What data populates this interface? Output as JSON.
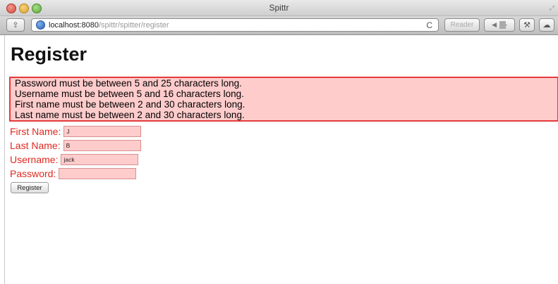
{
  "window": {
    "title": "Spittr"
  },
  "toolbar": {
    "url_host": "localhost:8080",
    "url_path": "/spittr/spitter/register",
    "reader_label": "Reader",
    "back_glyph": "◀",
    "forward_glyph": "▶",
    "reload_glyph": "C"
  },
  "page": {
    "heading": "Register",
    "errors": [
      "Password must be between 5 and 25 characters long.",
      "Username must be between 5 and 16 characters long.",
      "First name must be between 2 and 30 characters long.",
      "Last name must be between 2 and 30 characters long."
    ],
    "form": {
      "first_name_label": "First Name:",
      "first_name_value": "J",
      "last_name_label": "Last Name:",
      "last_name_value": "B",
      "username_label": "Username:",
      "username_value": "jack",
      "password_label": "Password:",
      "password_value": "",
      "submit_label": "Register"
    }
  },
  "colors": {
    "error_text": "#e0281f",
    "error_bg": "#ffcccc",
    "error_border": "#e43b3b"
  }
}
